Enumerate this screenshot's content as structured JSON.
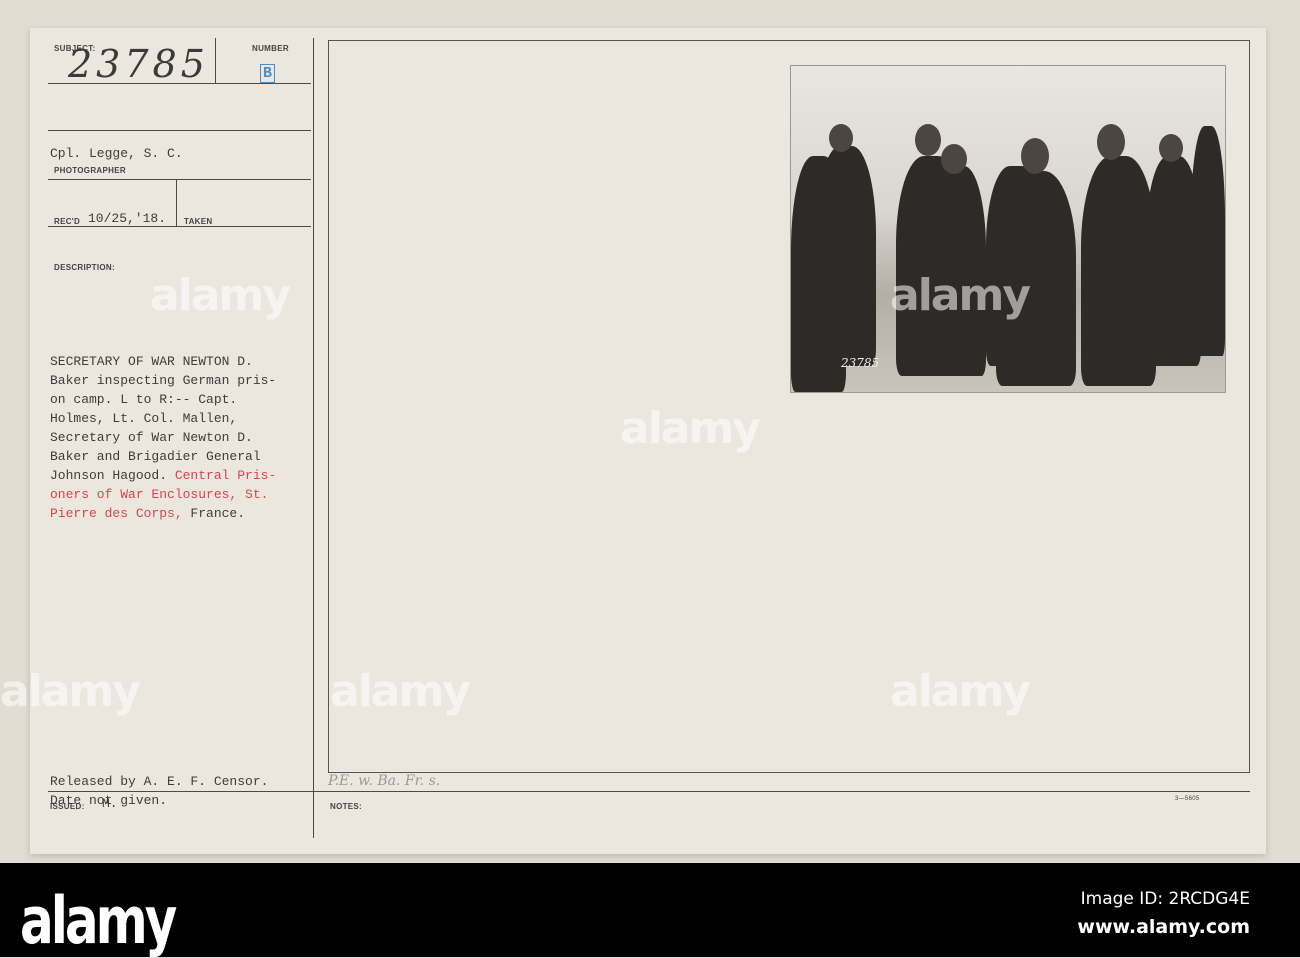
{
  "card": {
    "subject_label": "SUBJECT:",
    "subject_value": "23785",
    "number_label": "NUMBER",
    "number_stamp": "B",
    "photographer": "Cpl. Legge, S. C.",
    "photographer_label": "PHOTOGRAPHER",
    "recd_label": "REC'D",
    "recd_value": "10/25,'18.",
    "taken_label": "TAKEN",
    "description_label": "DESCRIPTION:",
    "description_black": "SECRETARY OF WAR NEWTON D.\nBaker inspecting German pris-\non camp. L to R:-- Capt.\nHolmes, Lt. Col. Mallen,\nSecretary of War Newton D.\nBaker and Brigadier General\nJohnson Hagood. ",
    "description_red_1": "Central Pris-",
    "description_red_2": "oners of War Enclosures, St.",
    "description_red_3": "Pierre des Corps,",
    "description_end": " France.",
    "release_note": "Released by A. E. F. Censor.\nDate not given.",
    "issued_label": "ISSUED:",
    "issued_value": "M.",
    "notes_label": "NOTES:",
    "handwritten_note": "P.E. w. Ba. Fr. s.",
    "form_number": "3—5605",
    "photo_number": "23785"
  },
  "watermark": {
    "text": "alamy",
    "image_id": "Image ID: 2RCDG4E",
    "url": "www.alamy.com"
  },
  "colors": {
    "card": "#ece7de",
    "red_type": "#d8454f",
    "stamp": "#4a8fc9"
  }
}
